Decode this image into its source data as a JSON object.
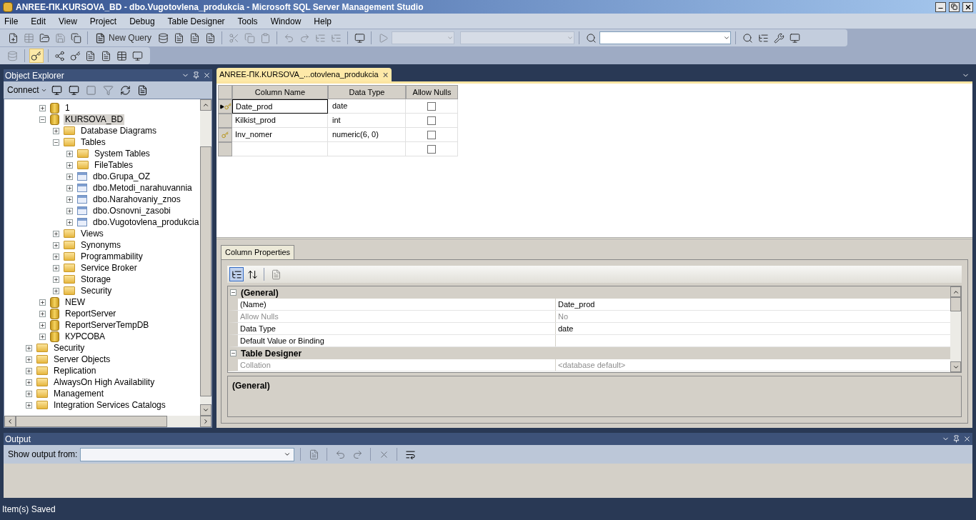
{
  "window": {
    "title": "ANREE-ПК.KURSOVA_BD - dbo.Vugotovlena_produkcia - Microsoft SQL Server Management Studio"
  },
  "menu": [
    "File",
    "Edit",
    "View",
    "Project",
    "Debug",
    "Table Designer",
    "Tools",
    "Window",
    "Help"
  ],
  "toolbar": {
    "new_query": "New Query"
  },
  "object_explorer": {
    "title": "Object Explorer",
    "connect": "Connect",
    "databases": [
      {
        "label": "1",
        "kind": "database",
        "expanded": false,
        "selected": false
      },
      {
        "label": "KURSOVA_BD",
        "kind": "database",
        "expanded": true,
        "selected": true,
        "children": [
          {
            "label": "Database Diagrams",
            "kind": "folder",
            "expanded": false,
            "selected": false
          },
          {
            "label": "Tables",
            "kind": "folder",
            "expanded": true,
            "selected": false,
            "children": [
              {
                "label": "System Tables",
                "kind": "folder",
                "expanded": false,
                "selected": false
              },
              {
                "label": "FileTables",
                "kind": "folder",
                "expanded": false,
                "selected": false
              },
              {
                "label": "dbo.Grupa_OZ",
                "kind": "table",
                "expanded": false,
                "selected": false
              },
              {
                "label": "dbo.Metodi_narahuvannia",
                "kind": "table",
                "expanded": false,
                "selected": false
              },
              {
                "label": "dbo.Narahovaniy_znos",
                "kind": "table",
                "expanded": false,
                "selected": false
              },
              {
                "label": "dbo.Osnovni_zasobi",
                "kind": "table",
                "expanded": false,
                "selected": false
              },
              {
                "label": "dbo.Vugotovlena_produkcia",
                "kind": "table",
                "expanded": false,
                "selected": false
              }
            ]
          },
          {
            "label": "Views",
            "kind": "folder",
            "expanded": false,
            "selected": false
          },
          {
            "label": "Synonyms",
            "kind": "folder",
            "expanded": false,
            "selected": false
          },
          {
            "label": "Programmability",
            "kind": "folder",
            "expanded": false,
            "selected": false
          },
          {
            "label": "Service Broker",
            "kind": "folder",
            "expanded": false,
            "selected": false
          },
          {
            "label": "Storage",
            "kind": "folder",
            "expanded": false,
            "selected": false
          },
          {
            "label": "Security",
            "kind": "folder",
            "expanded": false,
            "selected": false
          }
        ]
      },
      {
        "label": "NEW",
        "kind": "database",
        "expanded": false,
        "selected": false
      },
      {
        "label": "ReportServer",
        "kind": "database",
        "expanded": false,
        "selected": false
      },
      {
        "label": "ReportServerTempDB",
        "kind": "database",
        "expanded": false,
        "selected": false
      },
      {
        "label": "КУРСОВА",
        "kind": "database",
        "expanded": false,
        "selected": false
      }
    ],
    "server_nodes": [
      {
        "label": "Security",
        "kind": "folder",
        "expanded": false,
        "selected": false
      },
      {
        "label": "Server Objects",
        "kind": "folder",
        "expanded": false,
        "selected": false
      },
      {
        "label": "Replication",
        "kind": "folder",
        "expanded": false,
        "selected": false
      },
      {
        "label": "AlwaysOn High Availability",
        "kind": "folder",
        "expanded": false,
        "selected": false
      },
      {
        "label": "Management",
        "kind": "folder",
        "expanded": false,
        "selected": false
      },
      {
        "label": "Integration Services Catalogs",
        "kind": "folder",
        "expanded": false,
        "selected": false
      }
    ]
  },
  "document_tab": {
    "label": "ANREE-ПК.KURSOVA_...otovlena_produkcia",
    "close": "×"
  },
  "table_grid": {
    "columns": [
      "Column Name",
      "Data Type",
      "Allow Nulls"
    ],
    "rows": [
      {
        "column_name": "Date_prod",
        "data_type": "date",
        "allow_nulls": false,
        "current": true,
        "primary_key": true
      },
      {
        "column_name": "Kilkist_prod",
        "data_type": "int",
        "allow_nulls": false,
        "current": false,
        "primary_key": false
      },
      {
        "column_name": "Inv_nomer",
        "data_type": "numeric(6, 0)",
        "allow_nulls": false,
        "current": false,
        "primary_key": true
      },
      {
        "column_name": "",
        "data_type": "",
        "allow_nulls": false,
        "current": false,
        "primary_key": false
      }
    ]
  },
  "column_properties": {
    "tab": "Column Properties",
    "categories": [
      {
        "title": "(General)",
        "expanded": true,
        "items": [
          {
            "name": "(Name)",
            "value": "Date_prod",
            "disabled": false
          },
          {
            "name": "Allow Nulls",
            "value": "No",
            "disabled": true
          },
          {
            "name": "Data Type",
            "value": "date",
            "disabled": false
          },
          {
            "name": "Default Value or Binding",
            "value": "",
            "disabled": false
          }
        ]
      },
      {
        "title": "Table Designer",
        "expanded": true,
        "items": [
          {
            "name": "Collation",
            "value": "<database default>",
            "disabled": true
          }
        ]
      }
    ],
    "description_title": "(General)"
  },
  "output": {
    "title": "Output",
    "show_output_from": "Show output from:"
  },
  "status_bar": {
    "text": "Item(s) Saved"
  }
}
